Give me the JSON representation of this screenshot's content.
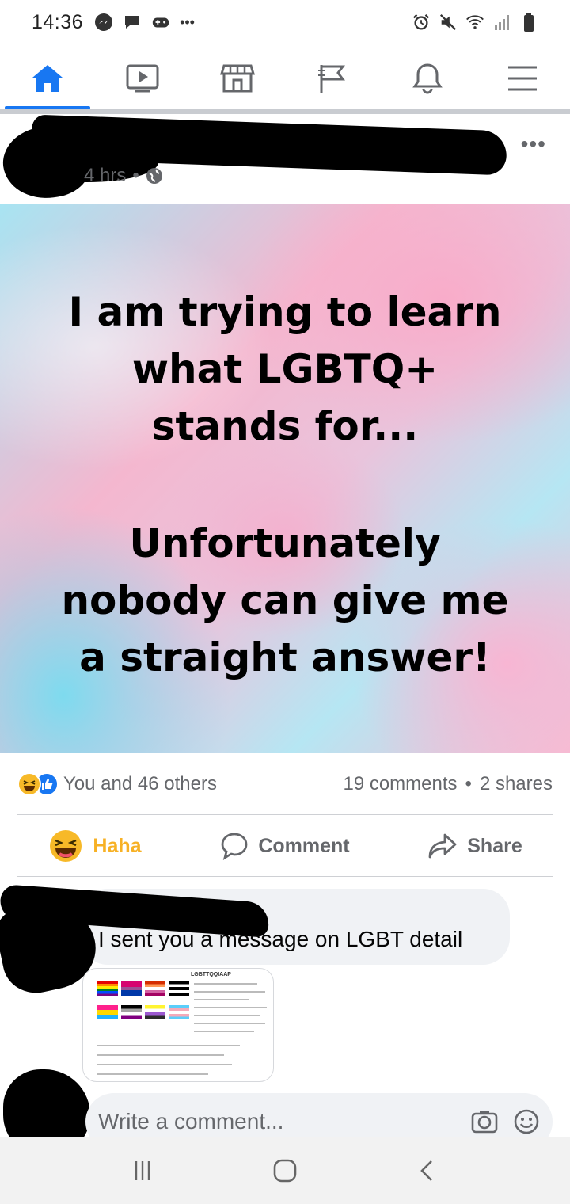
{
  "status_bar": {
    "time": "14:36",
    "left_icons": [
      "messenger-icon",
      "chat-icon",
      "game-icon",
      "more-dots-icon"
    ],
    "right_icons": [
      "alarm-icon",
      "mute-icon",
      "wifi-icon",
      "signal-icon",
      "battery-icon"
    ],
    "more": "•••"
  },
  "nav": {
    "items": [
      {
        "icon": "home-icon",
        "active": true
      },
      {
        "icon": "watch-icon",
        "active": false
      },
      {
        "icon": "marketplace-icon",
        "active": false
      },
      {
        "icon": "pages-flag-icon",
        "active": false
      },
      {
        "icon": "notifications-icon",
        "active": false
      },
      {
        "icon": "menu-icon",
        "active": false
      }
    ],
    "accent": "#1877f2"
  },
  "post": {
    "time": "4 hrs",
    "separator": "•",
    "privacy_icon": "globe-icon",
    "more": "•••",
    "image_text_1": "I am trying to learn what LGBTQ+ stands for...",
    "image_text_2": "Unfortunately nobody can give me a straight answer!"
  },
  "reactions": {
    "summary": "You and 46 others",
    "comments": "19 comments",
    "dot": "•",
    "shares": "2 shares"
  },
  "actions": {
    "haha": "Haha",
    "comment": "Comment",
    "share": "Share"
  },
  "comment": {
    "text": "I sent you a message on LGBT detail",
    "attachment_title": "LGBTTQQIAAP"
  },
  "writer": {
    "placeholder": "Write a comment..."
  }
}
